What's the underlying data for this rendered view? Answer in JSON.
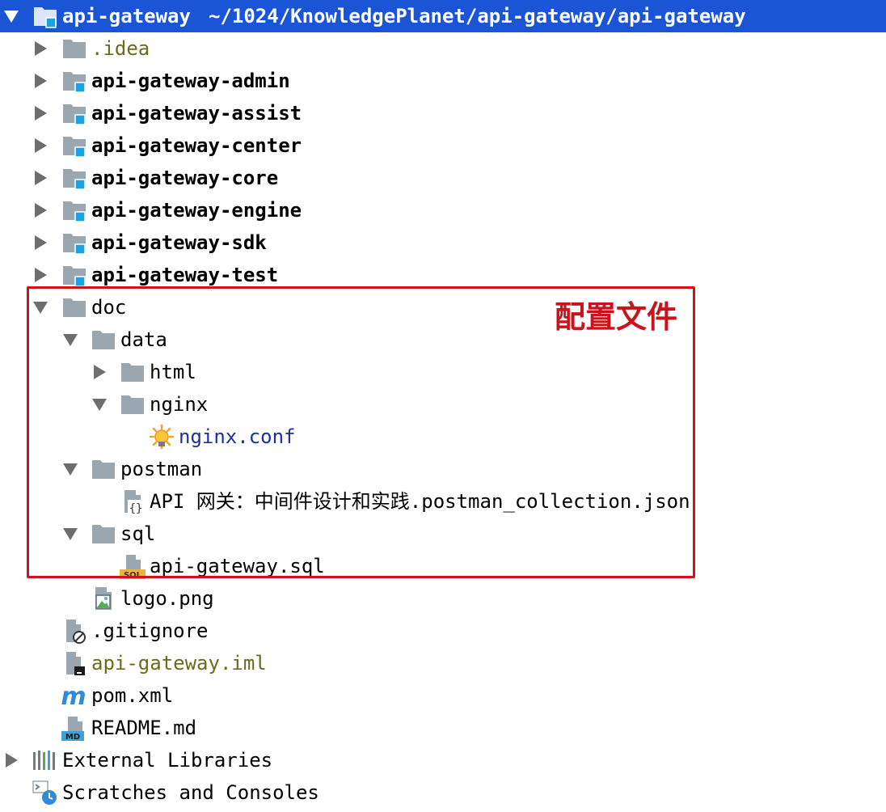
{
  "root": {
    "name": "api-gateway",
    "path": "~/1024/KnowledgePlanet/api-gateway/api-gateway",
    "expanded": true,
    "selected": true
  },
  "tree": [
    {
      "label": ".idea",
      "icon": "folder-icon",
      "expanded": false
    },
    {
      "label": "api-gateway-admin",
      "icon": "module-folder-icon",
      "expanded": false
    },
    {
      "label": "api-gateway-assist",
      "icon": "module-folder-icon",
      "expanded": false
    },
    {
      "label": "api-gateway-center",
      "icon": "module-folder-icon",
      "expanded": false
    },
    {
      "label": "api-gateway-core",
      "icon": "module-folder-icon",
      "expanded": false
    },
    {
      "label": "api-gateway-engine",
      "icon": "module-folder-icon",
      "expanded": false
    },
    {
      "label": "api-gateway-sdk",
      "icon": "module-folder-icon",
      "expanded": false
    },
    {
      "label": "api-gateway-test",
      "icon": "module-folder-icon",
      "expanded": false
    },
    {
      "label": "doc",
      "icon": "folder-icon",
      "expanded": true
    },
    {
      "label": "data",
      "icon": "folder-icon",
      "expanded": true
    },
    {
      "label": "html",
      "icon": "folder-icon",
      "expanded": false
    },
    {
      "label": "nginx",
      "icon": "folder-icon",
      "expanded": true
    },
    {
      "label": "nginx.conf",
      "icon": "config-file-icon"
    },
    {
      "label": "postman",
      "icon": "folder-icon",
      "expanded": true
    },
    {
      "label": "API 网关：中间件设计和实践.postman_collection.json",
      "icon": "json-file-icon"
    },
    {
      "label": "sql",
      "icon": "folder-icon",
      "expanded": true
    },
    {
      "label": "api-gateway.sql",
      "icon": "sql-file-icon"
    },
    {
      "label": "logo.png",
      "icon": "image-file-icon"
    },
    {
      "label": ".gitignore",
      "icon": "ignore-file-icon"
    },
    {
      "label": "api-gateway.iml",
      "icon": "iml-file-icon"
    },
    {
      "label": "pom.xml",
      "icon": "maven-icon"
    },
    {
      "label": "README.md",
      "icon": "markdown-file-icon"
    }
  ],
  "bottom": [
    {
      "label": "External Libraries",
      "icon": "libraries-icon",
      "expanded": false
    },
    {
      "label": "Scratches and Consoles",
      "icon": "scratches-icon"
    }
  ],
  "annotation": {
    "label": "配置文件",
    "color": "#c8141c"
  },
  "colors": {
    "selection": "#1a55d6",
    "folder": "#9aa7b0",
    "module_badge": "#1aa1e6",
    "olive_text": "#6b6b1e",
    "blue_text": "#1a2fa0"
  },
  "icon_text": {
    "sql": "SQL",
    "md": "MD",
    "maven": "m",
    "json_braces": "{}"
  }
}
